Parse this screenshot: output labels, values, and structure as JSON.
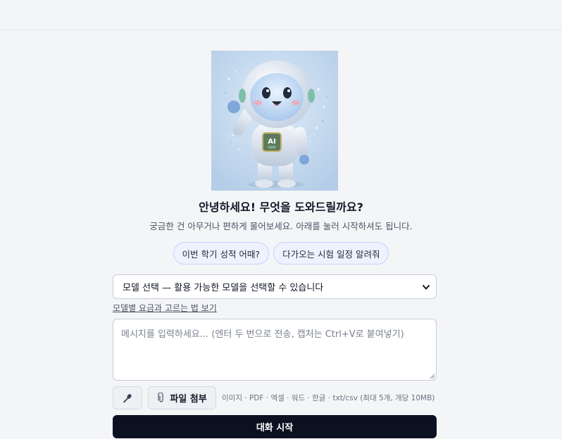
{
  "header": {},
  "hero": {
    "badge_text": "AI",
    "badge_subtext": "CORE"
  },
  "greeting": {
    "title": "안녕하세요! 무엇을 도와드릴까요?",
    "subtitle": "궁금한 건 아무거나 편하게 물어보세요. 아래를 눌러 시작하셔도 됩니다."
  },
  "suggestions": [
    {
      "label": "이번 학기 성적 어때?"
    },
    {
      "label": "다가오는 시험 일정 알려줘"
    }
  ],
  "model_select": {
    "selected": "모델 선택 — 활용 가능한 모델을 선택할 수 있습니다",
    "icon": "chevron-down-icon"
  },
  "guide_link": "모델별 요금과 고르는 법 보기",
  "composer": {
    "placeholder": "메시지를 입력하세요... (엔터 두 번으로 전송, 캡처는 Ctrl+V로 붙여넣기)",
    "value": ""
  },
  "toolbar": {
    "mic_icon": "microphone-icon",
    "attach_icon": "paperclip-icon",
    "attach_label": "파일 첨부",
    "attach_hint": "이미지 · PDF · 엑셀 · 워드 · 한글 · txt/csv (최대 5개, 개당 10MB)"
  },
  "start_button": {
    "label": "대화 시작"
  },
  "colors": {
    "background": "#f4f5f7",
    "chip_bg": "#eef2ff",
    "chip_border": "#c7d2fe",
    "primary_button": "#0b1120"
  }
}
